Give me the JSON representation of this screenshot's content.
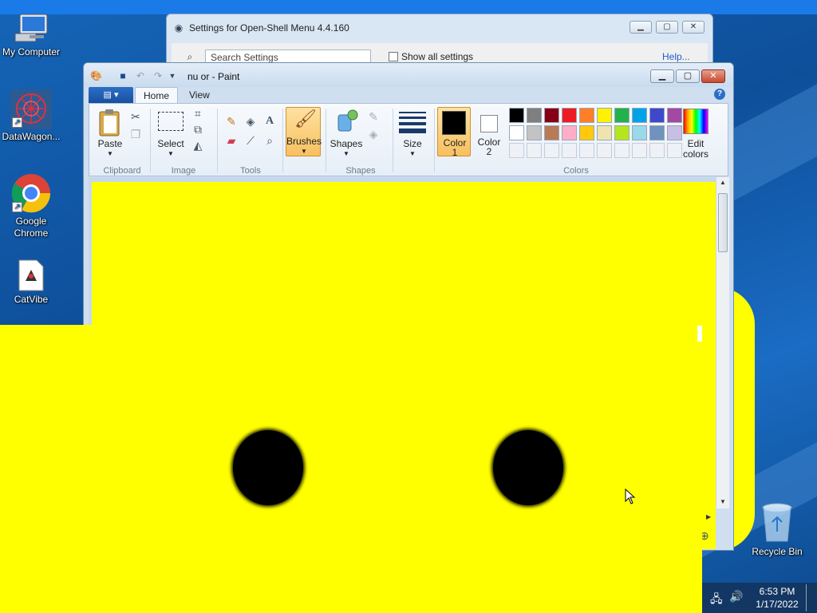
{
  "desktop": {
    "icons": [
      {
        "label": "My Computer",
        "icon": "computer-icon"
      },
      {
        "label": "DataWagon...",
        "icon": "datawagon-icon"
      },
      {
        "label": "Google Chrome",
        "icon": "chrome-icon"
      },
      {
        "label": "CatVibe",
        "icon": "catvibe-icon"
      },
      {
        "label": "Recycle Bin",
        "icon": "recycle-bin-icon"
      }
    ]
  },
  "settings_window": {
    "title": "Settings for Open-Shell Menu 4.4.160",
    "search_placeholder": "Search Settings",
    "show_all_label": "Show all settings",
    "help_link": "Help..."
  },
  "paint": {
    "title": "nu or - Paint",
    "tabs": {
      "home": "Home",
      "view": "View"
    },
    "clipboard": {
      "paste": "Paste",
      "group": "Clipboard"
    },
    "image": {
      "select": "Select",
      "group": "Image"
    },
    "tools": {
      "group": "Tools"
    },
    "brushes": {
      "label": "Brushes"
    },
    "shapes": {
      "label": "Shapes",
      "group": "Shapes"
    },
    "size": {
      "label": "Size"
    },
    "color1": {
      "label": "Color",
      "num": "1",
      "value": "#000000"
    },
    "color2": {
      "label": "Color",
      "num": "2",
      "value": "#ffffff"
    },
    "colors_group": "Colors",
    "edit_colors": {
      "line1": "Edit",
      "line2": "colors"
    },
    "palette_row1": [
      "#000000",
      "#7f7f7f",
      "#880015",
      "#ed1c24",
      "#ff7f27",
      "#fff200",
      "#22b14c",
      "#00a2e8",
      "#3f48cc",
      "#a349a4"
    ],
    "palette_row2": [
      "#ffffff",
      "#c3c3c3",
      "#b97a57",
      "#ffaec9",
      "#ffc90e",
      "#efe4b0",
      "#b5e61d",
      "#99d9ea",
      "#7092be",
      "#c8bfe7"
    ]
  },
  "tray": {
    "time": "6:53 PM",
    "date": "1/17/2022"
  }
}
